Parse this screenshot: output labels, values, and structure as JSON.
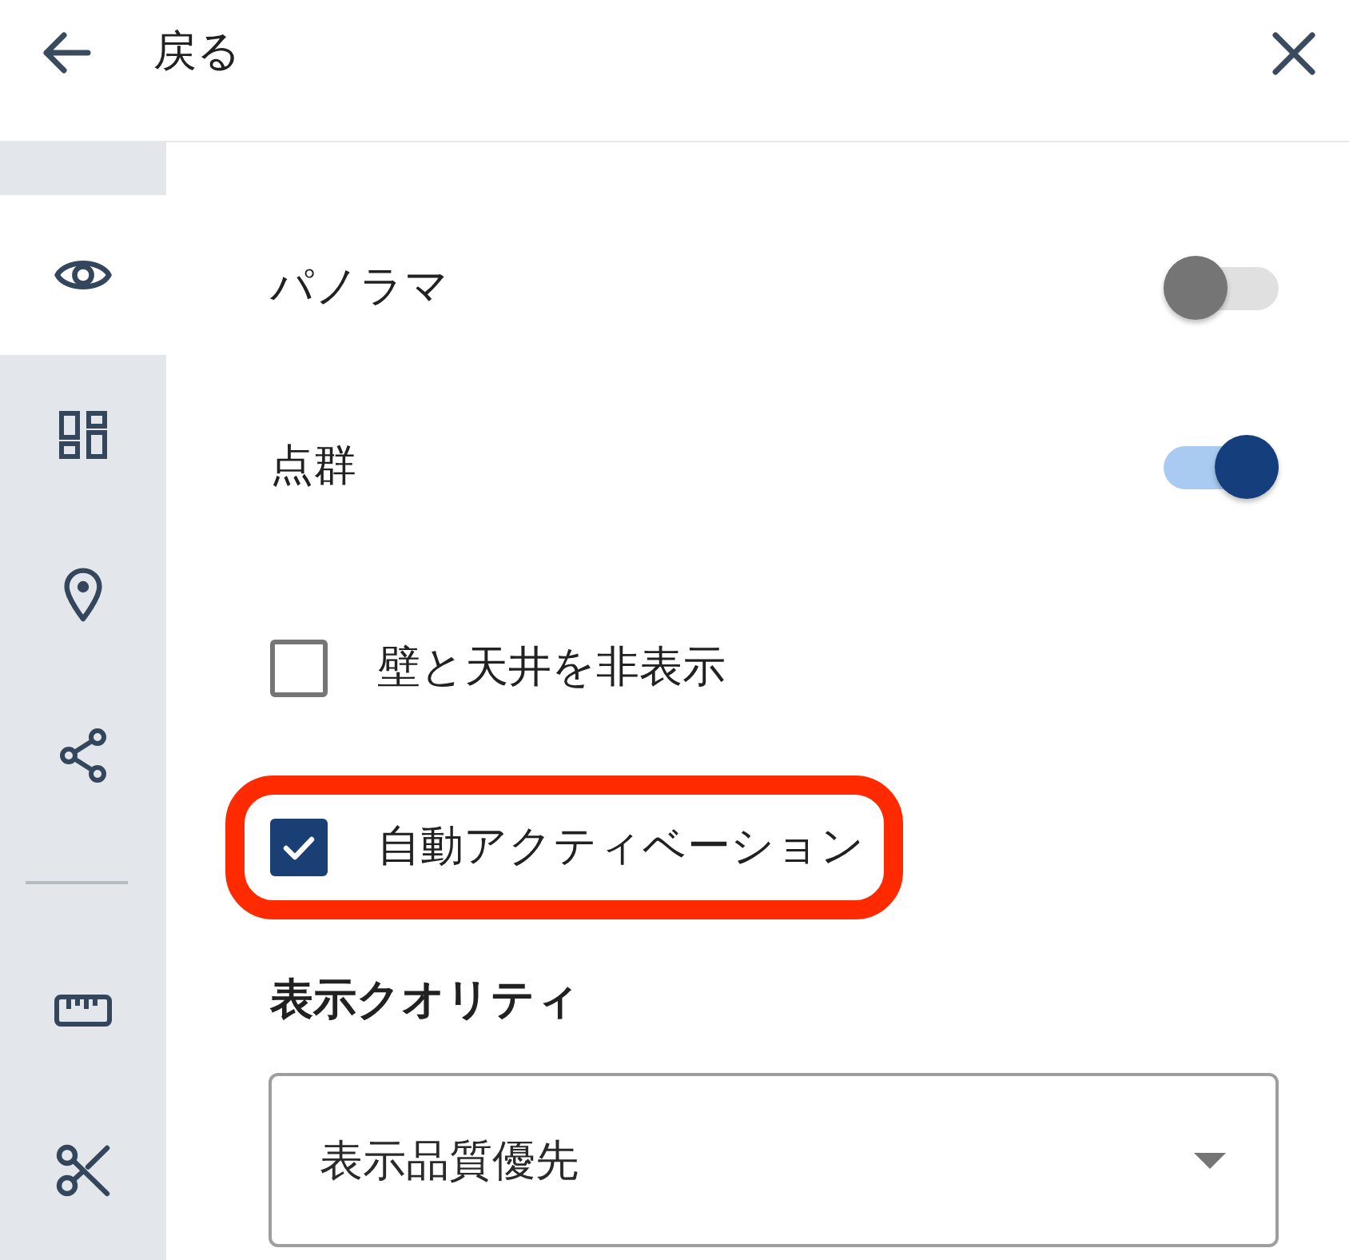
{
  "header": {
    "back_label": "戻る"
  },
  "sidebar": {
    "groups": [
      {
        "items": [
          {
            "selected": true
          },
          {
            "selected": false
          },
          {
            "selected": false
          },
          {
            "selected": false
          }
        ]
      },
      {
        "items": [
          {
            "selected": false
          },
          {
            "selected": false
          }
        ]
      }
    ]
  },
  "settings": [
    {
      "kind": "toggle",
      "label": "パノラマ",
      "on": false,
      "highlighted": false
    },
    {
      "kind": "toggle",
      "label": "点群",
      "on": true,
      "highlighted": false
    },
    {
      "kind": "checkbox",
      "label": "壁と天井を非表示",
      "checked": false,
      "highlighted": false
    },
    {
      "kind": "checkbox",
      "label": "自動アクティベーション",
      "checked": true,
      "highlighted": true
    }
  ],
  "quality": {
    "heading": "表示クオリティ",
    "select": {
      "value": "表示品質優先"
    }
  }
}
